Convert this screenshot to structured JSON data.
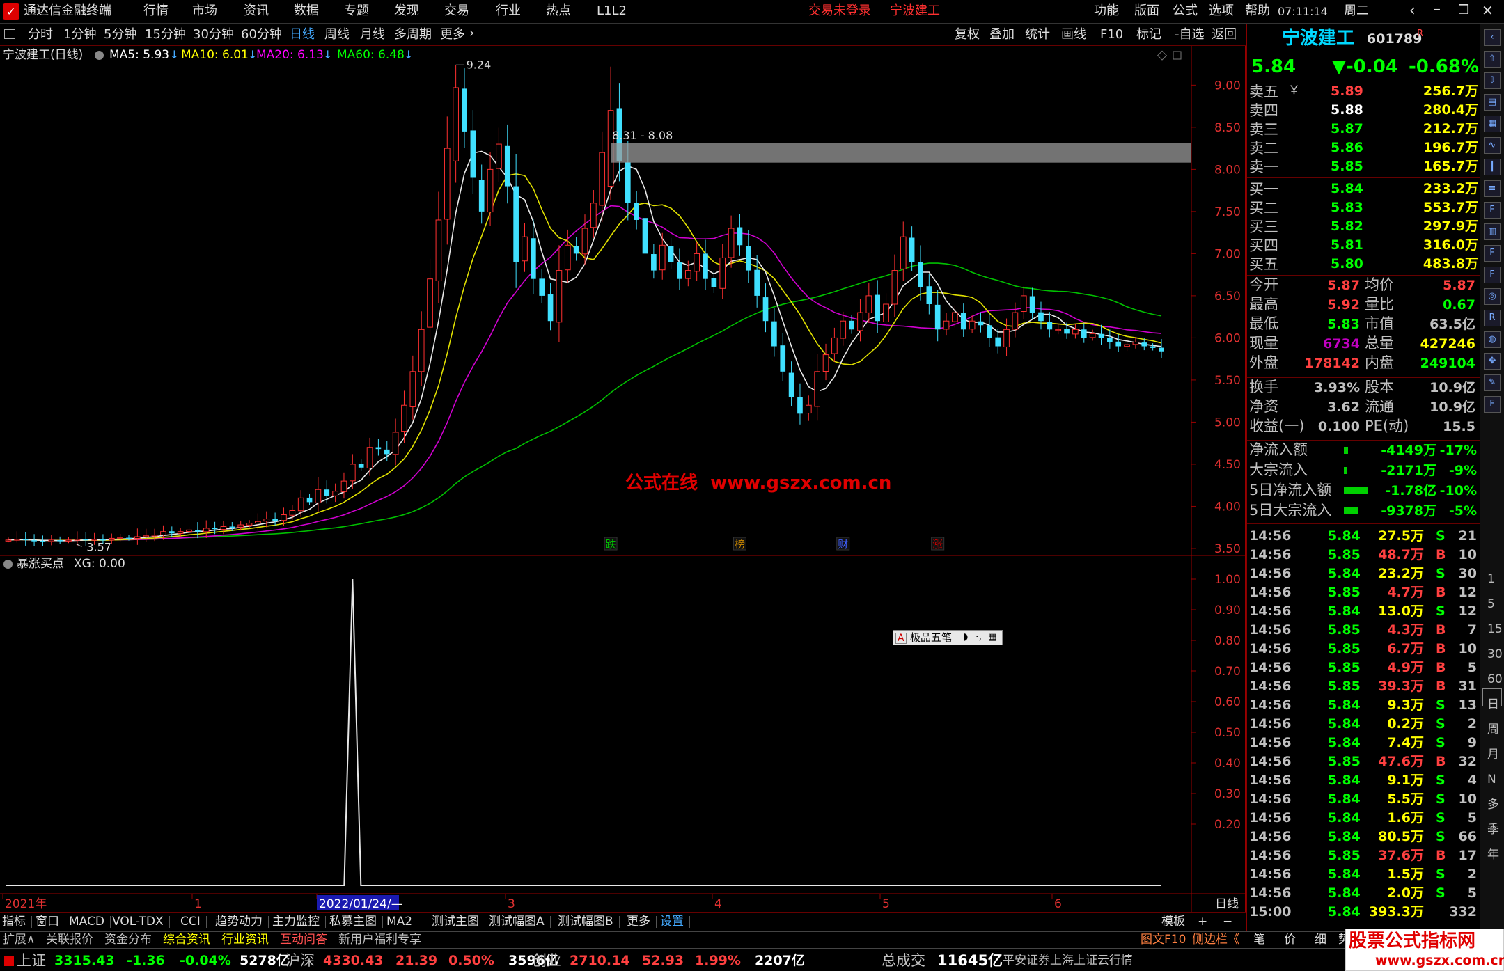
{
  "menu": {
    "app_name": "通达信金融终端",
    "items": [
      "行情",
      "市场",
      "资讯",
      "数据",
      "专题",
      "发现",
      "交易",
      "行业",
      "热点",
      "L1L2"
    ],
    "center_status": "交易未登录",
    "center_stock": "宁波建工",
    "right_items": [
      "功能",
      "版面",
      "公式",
      "选项",
      "帮助"
    ],
    "time": "07:11:14",
    "weekday": "周二"
  },
  "toolbar": {
    "periods": [
      "分时",
      "1分钟",
      "5分钟",
      "15分钟",
      "30分钟",
      "60分钟",
      "日线",
      "周线",
      "月线",
      "多周期",
      "更多"
    ],
    "active": "日线",
    "right_buttons": [
      "复权",
      "叠加",
      "统计",
      "画线",
      "F10",
      "标记",
      "-自选",
      "返回"
    ]
  },
  "chart_header": {
    "title": "宁波建工(日线)",
    "ma": [
      {
        "label": "MA5: 5.93",
        "color": "#ffffff"
      },
      {
        "label": "MA10: 6.01",
        "color": "#ffff00"
      },
      {
        "label": "MA20: 6.13",
        "color": "#ff00ff"
      },
      {
        "label": "MA60: 6.48",
        "color": "#00ff00"
      }
    ]
  },
  "chart_data": {
    "type": "candlestick",
    "y_ticks": [
      "9.00",
      "8.50",
      "8.00",
      "7.50",
      "7.00",
      "6.50",
      "6.00",
      "5.50",
      "5.00",
      "4.50",
      "4.00",
      "3.50"
    ],
    "ylim": [
      3.45,
      9.35
    ],
    "x_labels": [
      "2021年",
      "1",
      "2022/01/24/—",
      "3",
      "4",
      "5",
      "6"
    ],
    "annotations": {
      "high": "9.24",
      "low": "3.57",
      "zone": "8.31 - 8.08",
      "zone_range": [
        8.08,
        8.31
      ]
    },
    "event_marks": [
      {
        "label": "跌",
        "color": "#00c000"
      },
      {
        "label": "榜",
        "color": "#c08000"
      },
      {
        "label": "财",
        "color": "#4060ff"
      },
      {
        "label": "涨",
        "color": "#c00000"
      }
    ],
    "watermark": "公式在线  www.gszx.com.cn",
    "close": [
      3.6,
      3.61,
      3.6,
      3.59,
      3.58,
      3.6,
      3.59,
      3.6,
      3.61,
      3.6,
      3.61,
      3.6,
      3.62,
      3.63,
      3.62,
      3.64,
      3.65,
      3.66,
      3.7,
      3.68,
      3.7,
      3.72,
      3.7,
      3.74,
      3.73,
      3.76,
      3.75,
      3.78,
      3.8,
      3.82,
      3.85,
      3.83,
      3.9,
      3.95,
      4.1,
      4.05,
      4.2,
      4.12,
      4.18,
      4.3,
      4.5,
      4.46,
      4.7,
      4.68,
      4.62,
      4.88,
      5.2,
      5.6,
      6.1,
      6.7,
      7.4,
      8.25,
      8.97,
      8.45,
      7.9,
      7.5,
      8.0,
      8.3,
      7.8,
      6.9,
      7.2,
      6.7,
      6.5,
      6.2,
      6.8,
      7.1,
      7.0,
      7.3,
      7.6,
      8.2,
      8.7,
      8.1,
      7.6,
      7.4,
      7.0,
      6.8,
      7.1,
      6.9,
      6.7,
      6.8,
      7.0,
      6.7,
      6.6,
      6.95,
      7.3,
      7.1,
      6.8,
      6.5,
      6.2,
      5.9,
      5.6,
      5.3,
      5.1,
      5.2,
      5.6,
      5.8,
      6.0,
      6.2,
      6.1,
      6.3,
      6.5,
      6.2,
      6.4,
      6.8,
      7.2,
      6.9,
      6.6,
      6.4,
      6.1,
      6.2,
      6.3,
      6.1,
      6.2,
      6.15,
      6.0,
      5.9,
      6.1,
      6.3,
      6.5,
      6.3,
      6.2,
      6.1,
      6.1,
      6.05,
      6.1,
      6.0,
      6.05,
      6.0,
      5.95,
      5.9,
      5.92,
      5.95,
      5.9,
      5.88,
      5.84
    ],
    "indicator": {
      "title": "暴涨买点",
      "label": "XG: 0.00",
      "y_ticks": [
        "1.00",
        "0.90",
        "0.80",
        "0.70",
        "0.60",
        "0.50",
        "0.40",
        "0.30",
        "0.20"
      ],
      "ylim": [
        0,
        1.05
      ],
      "spike_index": 40
    }
  },
  "indicator_tabs": [
    "指标",
    "窗口",
    "MACD",
    "VOL-TDX",
    "CCI",
    "趋势动力",
    "主力监控",
    "私募主图",
    "MA2",
    "测试主图",
    "测试幅图A",
    "测试幅图B",
    "更多",
    "设置"
  ],
  "bottom_right_tabs": [
    "模板",
    "+",
    "−"
  ],
  "bottom_tabs": [
    {
      "label": "扩展∧",
      "color": "#c0c0c0"
    },
    {
      "label": "关联报价",
      "color": "#c0c0c0"
    },
    {
      "label": "资金分布",
      "color": "#c0c0c0"
    },
    {
      "label": "综合资讯",
      "color": "#ffff00"
    },
    {
      "label": "行业资讯",
      "color": "#ffff00"
    },
    {
      "label": "互动问答",
      "color": "#ff5050"
    },
    {
      "label": "新用户福利专享",
      "color": "#c0c0c0"
    }
  ],
  "bottom_right": {
    "f10": "图文F10",
    "sidebar_toggle": "侧边栏《",
    "tabs": [
      "笔",
      "价",
      "细",
      "势"
    ]
  },
  "ime_popup": "极品五笔",
  "quote": {
    "name": "宁波建工",
    "code": "601789",
    "flag": "R",
    "price": "5.84",
    "change": "▼-0.04",
    "pct": "-0.68%",
    "asks": [
      {
        "label": "卖五",
        "extra": "￥",
        "price": "5.89",
        "vol": "256.7万"
      },
      {
        "label": "卖四",
        "price": "5.88",
        "vol": "280.4万"
      },
      {
        "label": "卖三",
        "price": "5.87",
        "vol": "212.7万"
      },
      {
        "label": "卖二",
        "price": "5.86",
        "vol": "196.7万"
      },
      {
        "label": "卖一",
        "price": "5.85",
        "vol": "165.7万"
      }
    ],
    "bids": [
      {
        "label": "买一",
        "price": "5.84",
        "vol": "233.2万"
      },
      {
        "label": "买二",
        "price": "5.83",
        "vol": "553.7万"
      },
      {
        "label": "买三",
        "price": "5.82",
        "vol": "297.9万"
      },
      {
        "label": "买四",
        "price": "5.81",
        "vol": "316.0万"
      },
      {
        "label": "买五",
        "price": "5.80",
        "vol": "483.8万"
      }
    ],
    "stats": [
      [
        {
          "k": "今开",
          "v": "5.87",
          "c": "#ff4040"
        },
        {
          "k": "均价",
          "v": "5.87",
          "c": "#ff4040"
        }
      ],
      [
        {
          "k": "最高",
          "v": "5.92",
          "c": "#ff4040"
        },
        {
          "k": "量比",
          "v": "0.67",
          "c": "#00ff00"
        }
      ],
      [
        {
          "k": "最低",
          "v": "5.83",
          "c": "#00ff00"
        },
        {
          "k": "市值",
          "v": "63.5亿",
          "c": "#c0c0c0"
        }
      ],
      [
        {
          "k": "现量",
          "v": "6734",
          "c": "#c000c0"
        },
        {
          "k": "总量",
          "v": "427246",
          "c": "#ffff00"
        }
      ],
      [
        {
          "k": "外盘",
          "v": "178142",
          "c": "#ff4040"
        },
        {
          "k": "内盘",
          "v": "249104",
          "c": "#00ff00"
        }
      ]
    ],
    "stats2": [
      [
        {
          "k": "换手",
          "v": "3.93%",
          "c": "#c0c0c0"
        },
        {
          "k": "股本",
          "v": "10.9亿",
          "c": "#c0c0c0"
        }
      ],
      [
        {
          "k": "净资",
          "v": "3.62",
          "c": "#c0c0c0"
        },
        {
          "k": "流通",
          "v": "10.9亿",
          "c": "#c0c0c0"
        }
      ],
      [
        {
          "k": "收益(一)",
          "v": "0.100",
          "c": "#c0c0c0"
        },
        {
          "k": "PE(动)",
          "v": "15.5",
          "c": "#c0c0c0"
        }
      ]
    ],
    "flows": [
      {
        "k": "净流入额",
        "bar": 0.1,
        "v": "-4149万",
        "p": "-17%"
      },
      {
        "k": "大宗流入",
        "bar": 0.05,
        "v": "-2171万",
        "p": "-9%"
      },
      {
        "k": "5日净流入额",
        "bar": 0.9,
        "v": "-1.78亿",
        "p": "-10%"
      },
      {
        "k": "5日大宗流入",
        "bar": 0.5,
        "v": "-9378万",
        "p": "-5%"
      }
    ],
    "ticks": [
      {
        "t": "14:56",
        "p": "5.84",
        "v": "27.5万",
        "d": "S",
        "n": "21"
      },
      {
        "t": "14:56",
        "p": "5.85",
        "v": "48.7万",
        "d": "B",
        "n": "10"
      },
      {
        "t": "14:56",
        "p": "5.84",
        "v": "23.2万",
        "d": "S",
        "n": "30"
      },
      {
        "t": "14:56",
        "p": "5.85",
        "v": "4.7万",
        "d": "B",
        "n": "12"
      },
      {
        "t": "14:56",
        "p": "5.84",
        "v": "13.0万",
        "d": "S",
        "n": "12"
      },
      {
        "t": "14:56",
        "p": "5.85",
        "v": "4.3万",
        "d": "B",
        "n": "7"
      },
      {
        "t": "14:56",
        "p": "5.85",
        "v": "6.7万",
        "d": "B",
        "n": "10"
      },
      {
        "t": "14:56",
        "p": "5.85",
        "v": "4.9万",
        "d": "B",
        "n": "5"
      },
      {
        "t": "14:56",
        "p": "5.85",
        "v": "39.3万",
        "d": "B",
        "n": "31"
      },
      {
        "t": "14:56",
        "p": "5.84",
        "v": "9.3万",
        "d": "S",
        "n": "13"
      },
      {
        "t": "14:56",
        "p": "5.84",
        "v": "0.2万",
        "d": "S",
        "n": "2"
      },
      {
        "t": "14:56",
        "p": "5.84",
        "v": "7.4万",
        "d": "S",
        "n": "9"
      },
      {
        "t": "14:56",
        "p": "5.85",
        "v": "47.6万",
        "d": "B",
        "n": "32"
      },
      {
        "t": "14:56",
        "p": "5.84",
        "v": "9.1万",
        "d": "S",
        "n": "4"
      },
      {
        "t": "14:56",
        "p": "5.84",
        "v": "5.5万",
        "d": "S",
        "n": "10"
      },
      {
        "t": "14:56",
        "p": "5.84",
        "v": "1.6万",
        "d": "S",
        "n": "5"
      },
      {
        "t": "14:56",
        "p": "5.84",
        "v": "80.5万",
        "d": "S",
        "n": "66"
      },
      {
        "t": "14:56",
        "p": "5.85",
        "v": "37.6万",
        "d": "B",
        "n": "17"
      },
      {
        "t": "14:56",
        "p": "5.84",
        "v": "1.5万",
        "d": "S",
        "n": "2"
      },
      {
        "t": "14:56",
        "p": "5.84",
        "v": "2.0万",
        "d": "S",
        "n": "5"
      },
      {
        "t": "15:00",
        "p": "5.84",
        "v": "393.3万",
        "d": "",
        "n": "332"
      }
    ]
  },
  "sidebar": {
    "icons": [
      "collapse-icon",
      "up-icon",
      "down-icon",
      "news-icon",
      "table-icon",
      "chart-icon",
      "kline-icon",
      "list-icon",
      "f10-icon",
      "grid-icon",
      "f2-icon",
      "f5-icon",
      "circle-icon",
      "rss-icon",
      "globe-icon",
      "move-icon",
      "pen-icon",
      "f3-icon"
    ],
    "period_labels": [
      "1",
      "5",
      "15",
      "30",
      "60",
      "日",
      "周",
      "月",
      "N",
      "多",
      "季",
      "年"
    ]
  },
  "statusbar": {
    "indices": [
      {
        "name": "上证",
        "value": "3315.43",
        "chg": "-1.36",
        "pct": "-0.04%",
        "amt": "5278亿",
        "color": "#00ff00"
      },
      {
        "name": "沪深",
        "value": "4330.43",
        "chg": "21.39",
        "pct": "0.50%",
        "amt": "3596亿",
        "color": "#ff4040"
      },
      {
        "name": "创业",
        "value": "2710.14",
        "chg": "52.93",
        "pct": "1.99%",
        "amt": "2207亿",
        "color": "#ff4040"
      }
    ],
    "total_label": "总成交",
    "total": "11645亿",
    "broker": "平安证券上海上证云行情"
  },
  "logo": {
    "text": "股票公式指标网",
    "url": "www.gszx.com.cn"
  }
}
